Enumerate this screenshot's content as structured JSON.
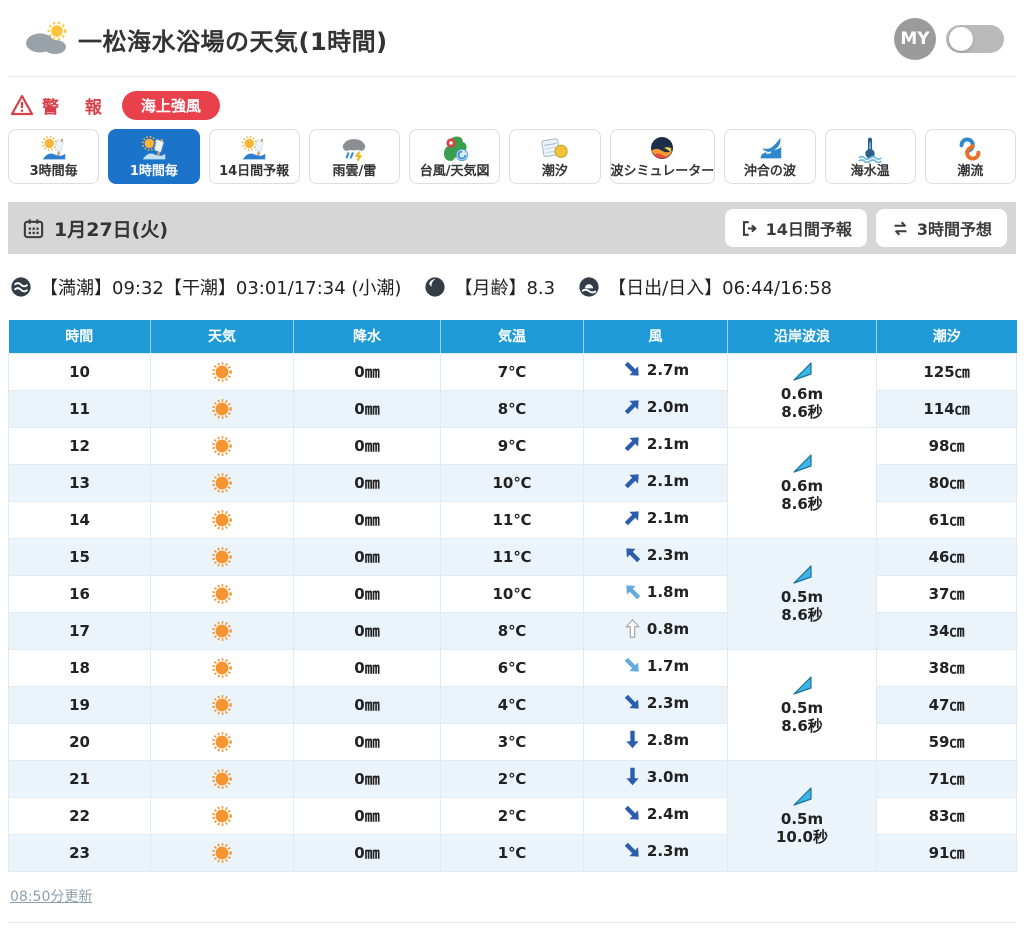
{
  "header": {
    "title": "一松海水浴場の天気(1時間)",
    "my_label": "MY",
    "my_toggle_state": "off"
  },
  "warning": {
    "label": "警 報",
    "badge": "海上強風"
  },
  "tabs": {
    "active_index": 1,
    "items": [
      {
        "label": "3時間毎"
      },
      {
        "label": "1時間毎"
      },
      {
        "label": "14日間予報"
      },
      {
        "label": "雨雲/雷"
      },
      {
        "label": "台風/天気図"
      },
      {
        "label": "潮汐"
      },
      {
        "label": "波シミュレーター"
      },
      {
        "label": "沖合の波"
      },
      {
        "label": "海水温"
      },
      {
        "label": "潮流"
      }
    ]
  },
  "date_bar": {
    "date": "1月27日(火)",
    "btn_14d": "14日間予報",
    "btn_3h": "3時間予想"
  },
  "tide_info": {
    "tide": "【満潮】09:32【干潮】03:01/17:34 (小潮)",
    "moon": "【月齢】8.3",
    "sun": "【日出/日入】06:44/16:58"
  },
  "table": {
    "headers": [
      "時間",
      "天気",
      "降水",
      "気温",
      "風",
      "沿岸波浪",
      "潮汐"
    ],
    "rows": [
      {
        "time": "10",
        "weather": "sunny",
        "precip": "0㎜",
        "temp": "7℃",
        "wind_speed": "2.7m",
        "wind_dir_deg": 135,
        "wind_level": "strong",
        "tide": "125㎝"
      },
      {
        "time": "11",
        "weather": "sunny",
        "precip": "0㎜",
        "temp": "8℃",
        "wind_speed": "2.0m",
        "wind_dir_deg": 45,
        "wind_level": "strong",
        "tide": "114㎝"
      },
      {
        "time": "12",
        "weather": "sunny",
        "precip": "0㎜",
        "temp": "9℃",
        "wind_speed": "2.1m",
        "wind_dir_deg": 45,
        "wind_level": "strong",
        "tide": "98㎝"
      },
      {
        "time": "13",
        "weather": "sunny",
        "precip": "0㎜",
        "temp": "10℃",
        "wind_speed": "2.1m",
        "wind_dir_deg": 45,
        "wind_level": "strong",
        "tide": "80㎝"
      },
      {
        "time": "14",
        "weather": "sunny",
        "precip": "0㎜",
        "temp": "11℃",
        "wind_speed": "2.1m",
        "wind_dir_deg": 45,
        "wind_level": "strong",
        "tide": "61㎝"
      },
      {
        "time": "15",
        "weather": "sunny",
        "precip": "0㎜",
        "temp": "11℃",
        "wind_speed": "2.3m",
        "wind_dir_deg": 315,
        "wind_level": "strong",
        "tide": "46㎝"
      },
      {
        "time": "16",
        "weather": "sunny",
        "precip": "0㎜",
        "temp": "10℃",
        "wind_speed": "1.8m",
        "wind_dir_deg": 315,
        "wind_level": "medium",
        "tide": "37㎝"
      },
      {
        "time": "17",
        "weather": "sunny",
        "precip": "0㎜",
        "temp": "8℃",
        "wind_speed": "0.8m",
        "wind_dir_deg": 0,
        "wind_level": "light",
        "tide": "34㎝"
      },
      {
        "time": "18",
        "weather": "sunny",
        "precip": "0㎜",
        "temp": "6℃",
        "wind_speed": "1.7m",
        "wind_dir_deg": 135,
        "wind_level": "medium",
        "tide": "38㎝"
      },
      {
        "time": "19",
        "weather": "sunny",
        "precip": "0㎜",
        "temp": "4℃",
        "wind_speed": "2.3m",
        "wind_dir_deg": 135,
        "wind_level": "strong",
        "tide": "47㎝"
      },
      {
        "time": "20",
        "weather": "sunny",
        "precip": "0㎜",
        "temp": "3℃",
        "wind_speed": "2.8m",
        "wind_dir_deg": 180,
        "wind_level": "strong",
        "tide": "59㎝"
      },
      {
        "time": "21",
        "weather": "sunny",
        "precip": "0㎜",
        "temp": "2℃",
        "wind_speed": "3.0m",
        "wind_dir_deg": 180,
        "wind_level": "strong",
        "tide": "71㎝"
      },
      {
        "time": "22",
        "weather": "sunny",
        "precip": "0㎜",
        "temp": "2℃",
        "wind_speed": "2.4m",
        "wind_dir_deg": 135,
        "wind_level": "strong",
        "tide": "83㎝"
      },
      {
        "time": "23",
        "weather": "sunny",
        "precip": "0㎜",
        "temp": "1℃",
        "wind_speed": "2.3m",
        "wind_dir_deg": 135,
        "wind_level": "strong",
        "tide": "91㎝"
      }
    ],
    "wave_groups": [
      {
        "start": 0,
        "span": 2,
        "height": "0.6m",
        "period": "8.6秒"
      },
      {
        "start": 2,
        "span": 3,
        "height": "0.6m",
        "period": "8.6秒"
      },
      {
        "start": 5,
        "span": 3,
        "height": "0.5m",
        "period": "8.6秒"
      },
      {
        "start": 8,
        "span": 3,
        "height": "0.5m",
        "period": "8.6秒"
      },
      {
        "start": 11,
        "span": 3,
        "height": "0.5m",
        "period": "10.0秒"
      }
    ]
  },
  "footer": {
    "updated": "08:50分更新"
  },
  "colors": {
    "table_header_blue": "#1e9bd7",
    "active_tab_blue": "#1c73ca",
    "alert_red": "#e8414b",
    "row_alt_blue": "#ecf4fb",
    "wind_strong_blue": "#2a5dae",
    "wind_medium_blue": "#63aadf",
    "wave_cyan": "#3cb6e8",
    "sun_orange": "#f6952f"
  }
}
